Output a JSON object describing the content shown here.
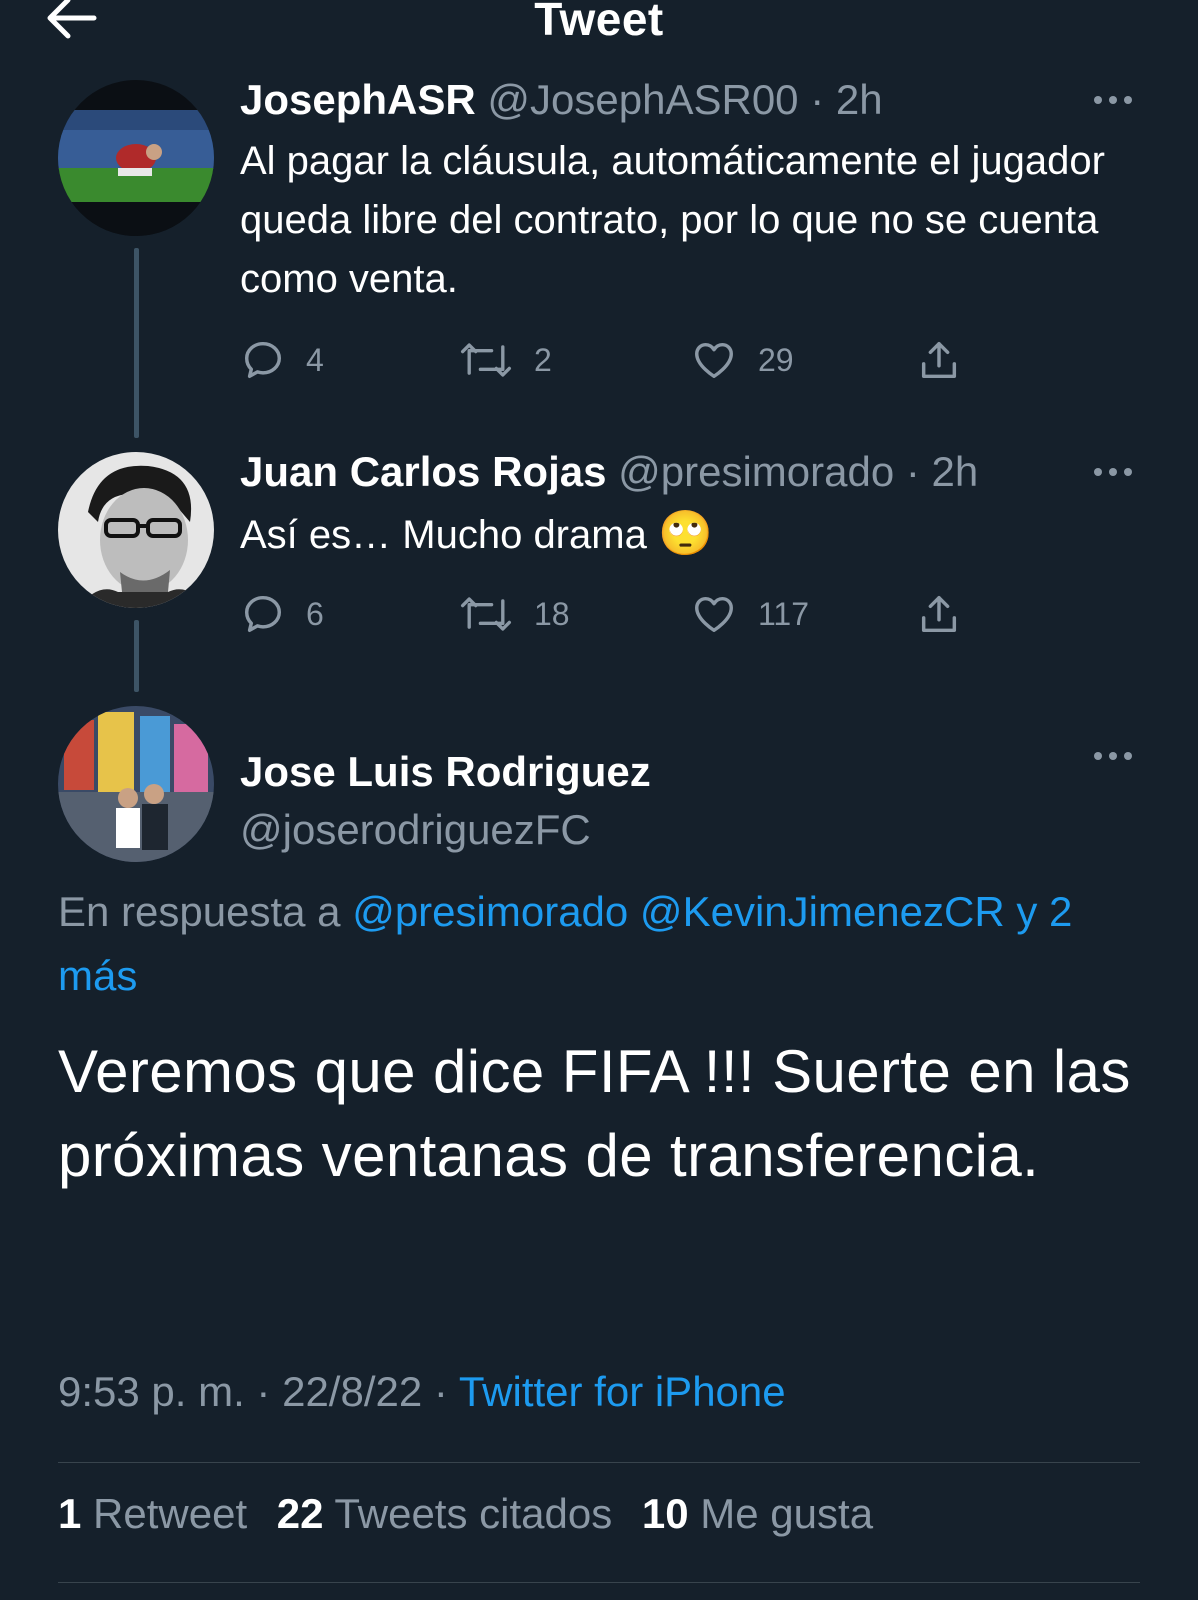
{
  "header": {
    "title": "Tweet",
    "back_icon": "arrow-left-icon"
  },
  "tweets": [
    {
      "name": "JosephASR",
      "handle": "@JosephASR00",
      "time": "2h",
      "text": "Al pagar la cláusula, automáticamente el jugador queda libre del contrato, por lo que no se cuenta como venta.",
      "replies": "4",
      "retweets": "2",
      "likes": "29"
    },
    {
      "name": "Juan Carlos Rojas",
      "handle": "@presimorado",
      "time": "2h",
      "text": "Así es… Mucho drama",
      "emoji": "🙄",
      "replies": "6",
      "retweets": "18",
      "likes": "117"
    }
  ],
  "main_tweet": {
    "name": "Jose Luis Rodriguez",
    "handle": "@joserodriguezFC",
    "reply_prefix": "En respuesta a",
    "reply_users": "@presimorado @KevinJimenezCR y 2 más",
    "text": "Veremos que dice FIFA !!! Suerte en las próximas ventanas de transferencia.",
    "time": "9:53 p. m.",
    "date": "22/8/22",
    "source": "Twitter for iPhone",
    "retweets_count": "1",
    "retweets_label": "Retweet",
    "quotes_count": "22",
    "quotes_label": "Tweets citados",
    "likes_count": "10",
    "likes_label": "Me gusta"
  },
  "colors": {
    "background": "#15202b",
    "accent": "#1d9bf0",
    "muted": "#8b98a5",
    "divider": "#38444d"
  }
}
